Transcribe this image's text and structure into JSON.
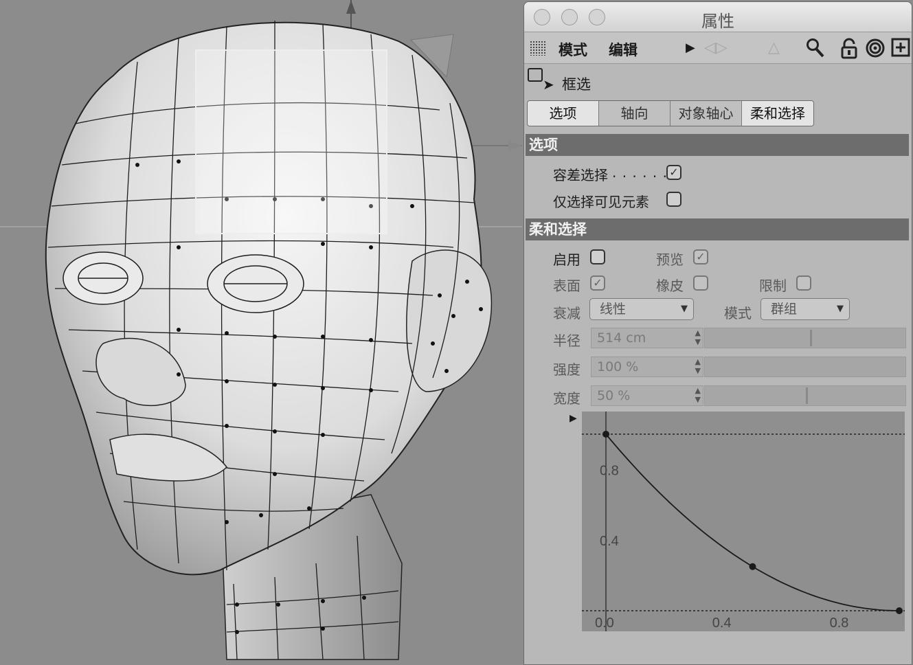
{
  "window": {
    "title": "属性"
  },
  "toolbar": {
    "menu_mode": "模式",
    "menu_edit": "编辑"
  },
  "mode": {
    "label": "框选"
  },
  "tabs": [
    "选项",
    "轴向",
    "对象轴心",
    "柔和选择"
  ],
  "options": {
    "header": "选项",
    "tolerance_label": "容差选择",
    "tolerance_dots": ". . . . . .",
    "tolerance_checked": true,
    "visible_only_label": "仅选择可见元素",
    "visible_only_checked": false
  },
  "soft": {
    "header": "柔和选择",
    "enable_label": "启用",
    "enable_checked": false,
    "preview_label": "预览",
    "preview_checked": true,
    "surface_label": "表面",
    "surface_checked": true,
    "rubber_label": "橡皮",
    "rubber_checked": false,
    "limit_label": "限制",
    "limit_checked": false,
    "falloff_label": "衰减",
    "falloff_value": "线性",
    "mode_label": "模式",
    "mode_value": "群组",
    "radius_label": "半径",
    "radius_value": "514 cm",
    "radius_fraction": 0.52,
    "strength_label": "强度",
    "strength_value": "100 %",
    "strength_fraction": 1.0,
    "width_label": "宽度",
    "width_value": "50 %",
    "width_fraction": 0.5
  },
  "curve": {
    "y_ticks": [
      "0.8",
      "0.4"
    ],
    "x_ticks": [
      "0.0",
      "0.4",
      "0.8"
    ],
    "points": [
      [
        0.0,
        1.0
      ],
      [
        0.5,
        0.25
      ],
      [
        1.0,
        0.0
      ]
    ]
  },
  "colors": {
    "section": "#6d6d6d",
    "panel": "#b8b8b8",
    "graph_bg": "#8f8f8f"
  }
}
